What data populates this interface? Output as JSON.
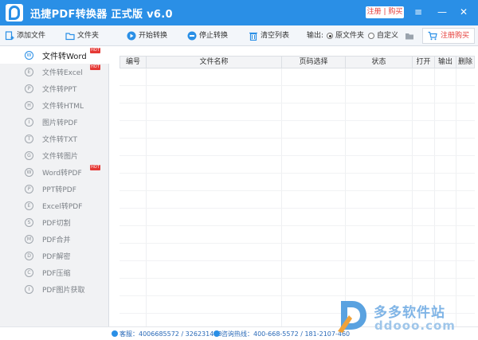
{
  "app": {
    "title": "迅捷PDF转换器 正式版 v6.0",
    "register_buy": "注册 | 购买",
    "window": {
      "menu_glyph": "≡",
      "minimize_glyph": "—",
      "close_glyph": "✕"
    }
  },
  "toolbar": {
    "add_file": "添加文件",
    "add_folder": "文件夹",
    "start": "开始转换",
    "stop": "停止转换",
    "clear": "清空列表",
    "output_label": "输出:",
    "output_original": "原文件夹",
    "output_custom": "自定义",
    "output_selected": "原文件夹",
    "buy": "注册购买",
    "icons": {
      "add_file": "add-file-icon",
      "add_folder": "folder-icon",
      "start": "play-icon",
      "stop": "stop-icon",
      "clear": "trash-icon",
      "browse": "folder-browse-icon",
      "buy": "cart-icon"
    }
  },
  "sidebar": {
    "items": [
      {
        "label": "文件转Word",
        "hot": true,
        "active": true,
        "glyph": "W"
      },
      {
        "label": "文件转Excel",
        "hot": true,
        "active": false,
        "glyph": "E"
      },
      {
        "label": "文件转PPT",
        "hot": false,
        "active": false,
        "glyph": "P"
      },
      {
        "label": "文件转HTML",
        "hot": false,
        "active": false,
        "glyph": "H"
      },
      {
        "label": "图片转PDF",
        "hot": false,
        "active": false,
        "glyph": "I"
      },
      {
        "label": "文件转TXT",
        "hot": false,
        "active": false,
        "glyph": "T"
      },
      {
        "label": "文件转图片",
        "hot": false,
        "active": false,
        "glyph": "G"
      },
      {
        "label": "Word转PDF",
        "hot": true,
        "active": false,
        "glyph": "W"
      },
      {
        "label": "PPT转PDF",
        "hot": false,
        "active": false,
        "glyph": "P"
      },
      {
        "label": "Excel转PDF",
        "hot": false,
        "active": false,
        "glyph": "E"
      },
      {
        "label": "PDF切割",
        "hot": false,
        "active": false,
        "glyph": "S"
      },
      {
        "label": "PDF合并",
        "hot": false,
        "active": false,
        "glyph": "M"
      },
      {
        "label": "PDF解密",
        "hot": false,
        "active": false,
        "glyph": "D"
      },
      {
        "label": "PDF压缩",
        "hot": false,
        "active": false,
        "glyph": "C"
      },
      {
        "label": "PDF图片获取",
        "hot": false,
        "active": false,
        "glyph": "I"
      }
    ],
    "hot_badge": "HOT"
  },
  "table": {
    "columns": [
      "编号",
      "文件名称",
      "页码选择",
      "状态",
      "打开",
      "输出",
      "删除"
    ],
    "rows": []
  },
  "status": {
    "qq": "客服：4006685572 / 326231478",
    "hotline": "咨询热线：400-668-5572 / 181-2107-460"
  },
  "watermark": {
    "cn": "多多软件站",
    "en": "ddooo.com"
  },
  "colors": {
    "title_bar": "#2a8fe6",
    "accent_red": "#e53935",
    "sidebar_bg": "#f1f2f4"
  }
}
